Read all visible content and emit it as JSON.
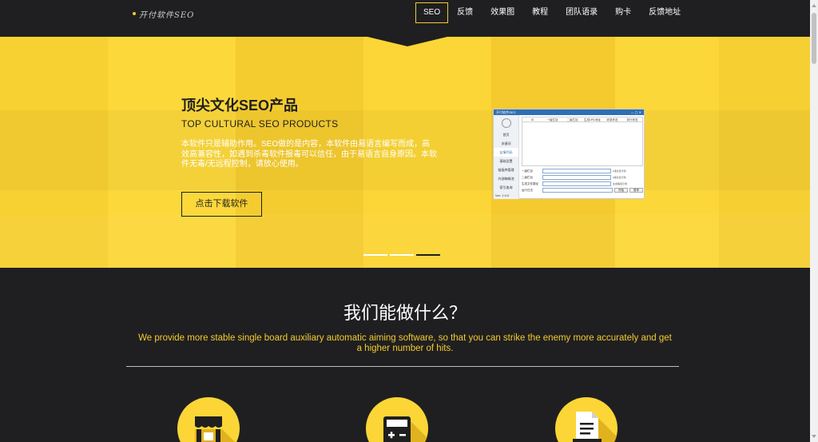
{
  "nav": {
    "logo_text": "开付软件SEO",
    "items": [
      {
        "label": "SEO",
        "active": true
      },
      {
        "label": "反馈",
        "active": false
      },
      {
        "label": "效果图",
        "active": false
      },
      {
        "label": "教程",
        "active": false
      },
      {
        "label": "团队语录",
        "active": false
      },
      {
        "label": "购卡",
        "active": false
      },
      {
        "label": "反馈地址",
        "active": false
      }
    ]
  },
  "hero": {
    "title": "顶尖文化SEO产品",
    "subtitle": "TOP CULTURAL SEO PRODUCTS",
    "description": "本软件只是辅助作用。SEO做的是内容，本软件由易语言编写而成，高效高兼容性，如遇到杀毒软件报毒可以信任，由于易语言自身原因。本软件无毒/无远程控制，请放心使用。",
    "download_button": "点击下载软件",
    "slides": 3,
    "active_slide": 3
  },
  "app_preview": {
    "sidebar_items": [
      "首页",
      "关键词",
      "友情代码",
      "基础设置",
      "链接库管理",
      "外部蜘蛛池",
      "索引查询"
    ],
    "selected_index": 2,
    "version": "Ver: 1.0.0",
    "table_headers": [
      "ID",
      "一级栏目",
      "二级栏目",
      "生成URL地址",
      "收录状态",
      "执行状态"
    ],
    "form_rows": [
      {
        "label": "一级栏目",
        "note": "1级栏目示例"
      },
      {
        "label": "二级栏目",
        "note": "2级栏目示例"
      },
      {
        "label": "生成文件路径",
        "note": "生成路径示例"
      },
      {
        "label": "运行日志",
        "note": ""
      }
    ],
    "buttons": [
      "开始",
      "暂停"
    ]
  },
  "section": {
    "title": "我们能做什么？",
    "description": "We provide more stable single board auxiliary automatic aiming software, so that you can strike the enemy more accurately and get a higher number of hits."
  },
  "features": [
    {
      "icon": "shop-icon"
    },
    {
      "icon": "calculator-icon"
    },
    {
      "icon": "document-icon"
    }
  ],
  "colors": {
    "accent": "#fbd636",
    "dark": "#1f1f21",
    "text_accent": "#f3cb2e"
  }
}
